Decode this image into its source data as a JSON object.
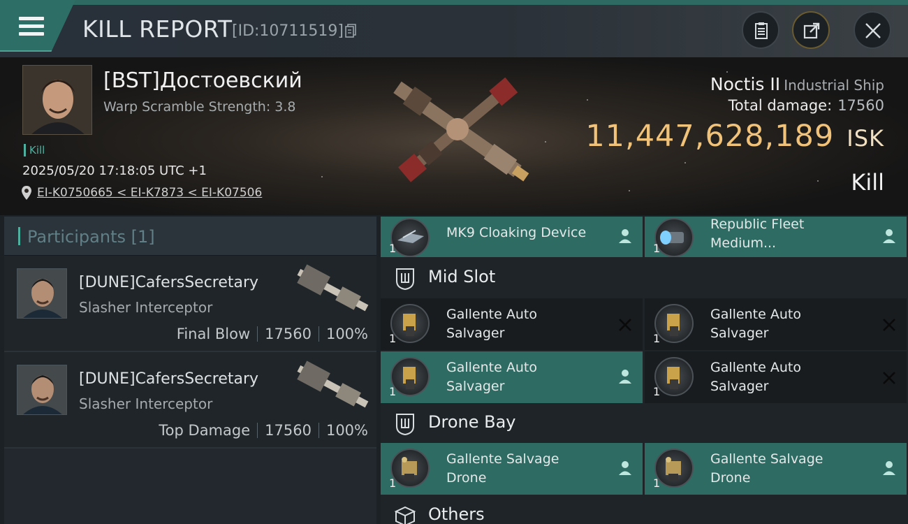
{
  "header": {
    "title": "KILL REPORT",
    "report_id": "[ID:10711519]"
  },
  "victim": {
    "name": "[BST]Достоевский",
    "warp_scramble": "Warp Scramble Strength: 3.8",
    "tag": "Kill",
    "time": "2025/05/20 17:18:05 UTC +1",
    "location": "EI-K0750665 < EI-K7873 < EI-K07506"
  },
  "ship": {
    "name": "Noctis II",
    "class": "Industrial Ship",
    "total_damage_label": "Total damage:",
    "total_damage": "17560",
    "isk_value": "11,447,628,189",
    "isk_unit": "ISK",
    "result": "Kill"
  },
  "participants": {
    "header": "Participants [1]",
    "items": [
      {
        "name": "[DUNE]CafersSecretary",
        "ship": "Slasher Interceptor",
        "role": "Final Blow",
        "damage": "17560",
        "percent": "100%"
      },
      {
        "name": "[DUNE]CafersSecretary",
        "ship": "Slasher Interceptor",
        "role": "Top Damage",
        "damage": "17560",
        "percent": "100%"
      }
    ]
  },
  "fittings": {
    "top_row": [
      {
        "qty": "1",
        "name": "MK9 Cloaking Device",
        "state": "dropped",
        "icon": "cloaking-device-icon"
      },
      {
        "qty": "1",
        "name_line1": "Republic Fleet",
        "name_line2": "Medium...",
        "state": "dropped",
        "icon": "afterburner-icon"
      }
    ],
    "mid_slot_label": "Mid Slot",
    "mid_slot": [
      {
        "qty": "1",
        "name_line1": "Gallente Auto",
        "name_line2": "Salvager",
        "state": "destroyed",
        "icon": "salvager-icon"
      },
      {
        "qty": "1",
        "name_line1": "Gallente Auto",
        "name_line2": "Salvager",
        "state": "destroyed",
        "icon": "salvager-icon"
      },
      {
        "qty": "1",
        "name_line1": "Gallente Auto",
        "name_line2": "Salvager",
        "state": "dropped",
        "icon": "salvager-icon"
      },
      {
        "qty": "1",
        "name_line1": "Gallente Auto",
        "name_line2": "Salvager",
        "state": "destroyed",
        "icon": "salvager-icon"
      }
    ],
    "drone_bay_label": "Drone Bay",
    "drone_bay": [
      {
        "qty": "1",
        "name_line1": "Gallente Salvage",
        "name_line2": "Drone",
        "state": "dropped",
        "icon": "salvage-drone-icon"
      },
      {
        "qty": "1",
        "name_line1": "Gallente Salvage",
        "name_line2": "Drone",
        "state": "dropped",
        "icon": "salvage-drone-icon"
      }
    ],
    "others_label": "Others"
  },
  "colors": {
    "accent_teal": "#2e6b62",
    "isk_gold": "#f0c27a"
  }
}
